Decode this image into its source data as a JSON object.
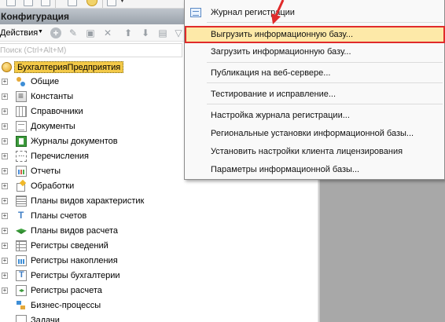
{
  "config_panel": {
    "title": "Конфигурация",
    "actions_label": "Действия",
    "search_placeholder": "Поиск (Ctrl+Alt+M)"
  },
  "tree": {
    "root": "БухгалтерияПредприятия",
    "items": [
      {
        "label": "Общие",
        "icon": "general-icon"
      },
      {
        "label": "Константы",
        "icon": "constants-icon"
      },
      {
        "label": "Справочники",
        "icon": "catalogs-icon"
      },
      {
        "label": "Документы",
        "icon": "documents-icon"
      },
      {
        "label": "Журналы документов",
        "icon": "document-journals-icon"
      },
      {
        "label": "Перечисления",
        "icon": "enumerations-icon"
      },
      {
        "label": "Отчеты",
        "icon": "reports-icon"
      },
      {
        "label": "Обработки",
        "icon": "data-processors-icon"
      },
      {
        "label": "Планы видов характеристик",
        "icon": "characteristic-types-icon"
      },
      {
        "label": "Планы счетов",
        "icon": "charts-of-accounts-icon"
      },
      {
        "label": "Планы видов расчета",
        "icon": "calculation-types-icon"
      },
      {
        "label": "Регистры сведений",
        "icon": "information-registers-icon"
      },
      {
        "label": "Регистры накопления",
        "icon": "accumulation-registers-icon"
      },
      {
        "label": "Регистры бухгалтерии",
        "icon": "accounting-registers-icon"
      },
      {
        "label": "Регистры расчета",
        "icon": "calculation-registers-icon"
      },
      {
        "label": "Бизнес-процессы",
        "icon": "business-processes-icon"
      },
      {
        "label": "Задачи",
        "icon": "tasks-icon"
      }
    ]
  },
  "menu": {
    "items": [
      "Журнал регистрации",
      "Выгрузить информационную базу...",
      "Загрузить информационную базу...",
      "Публикация на веб-сервере...",
      "Тестирование и исправление...",
      "Настройка журнала регистрации...",
      "Региональные установки информационной базы...",
      "Установить настройки клиента лицензирования",
      "Параметры информационной базы..."
    ],
    "highlighted_index": 1
  },
  "colors": {
    "highlight_box": "#e02b2b",
    "hover_row": "#fde9a8",
    "root_label_bg": "#f3c948"
  }
}
